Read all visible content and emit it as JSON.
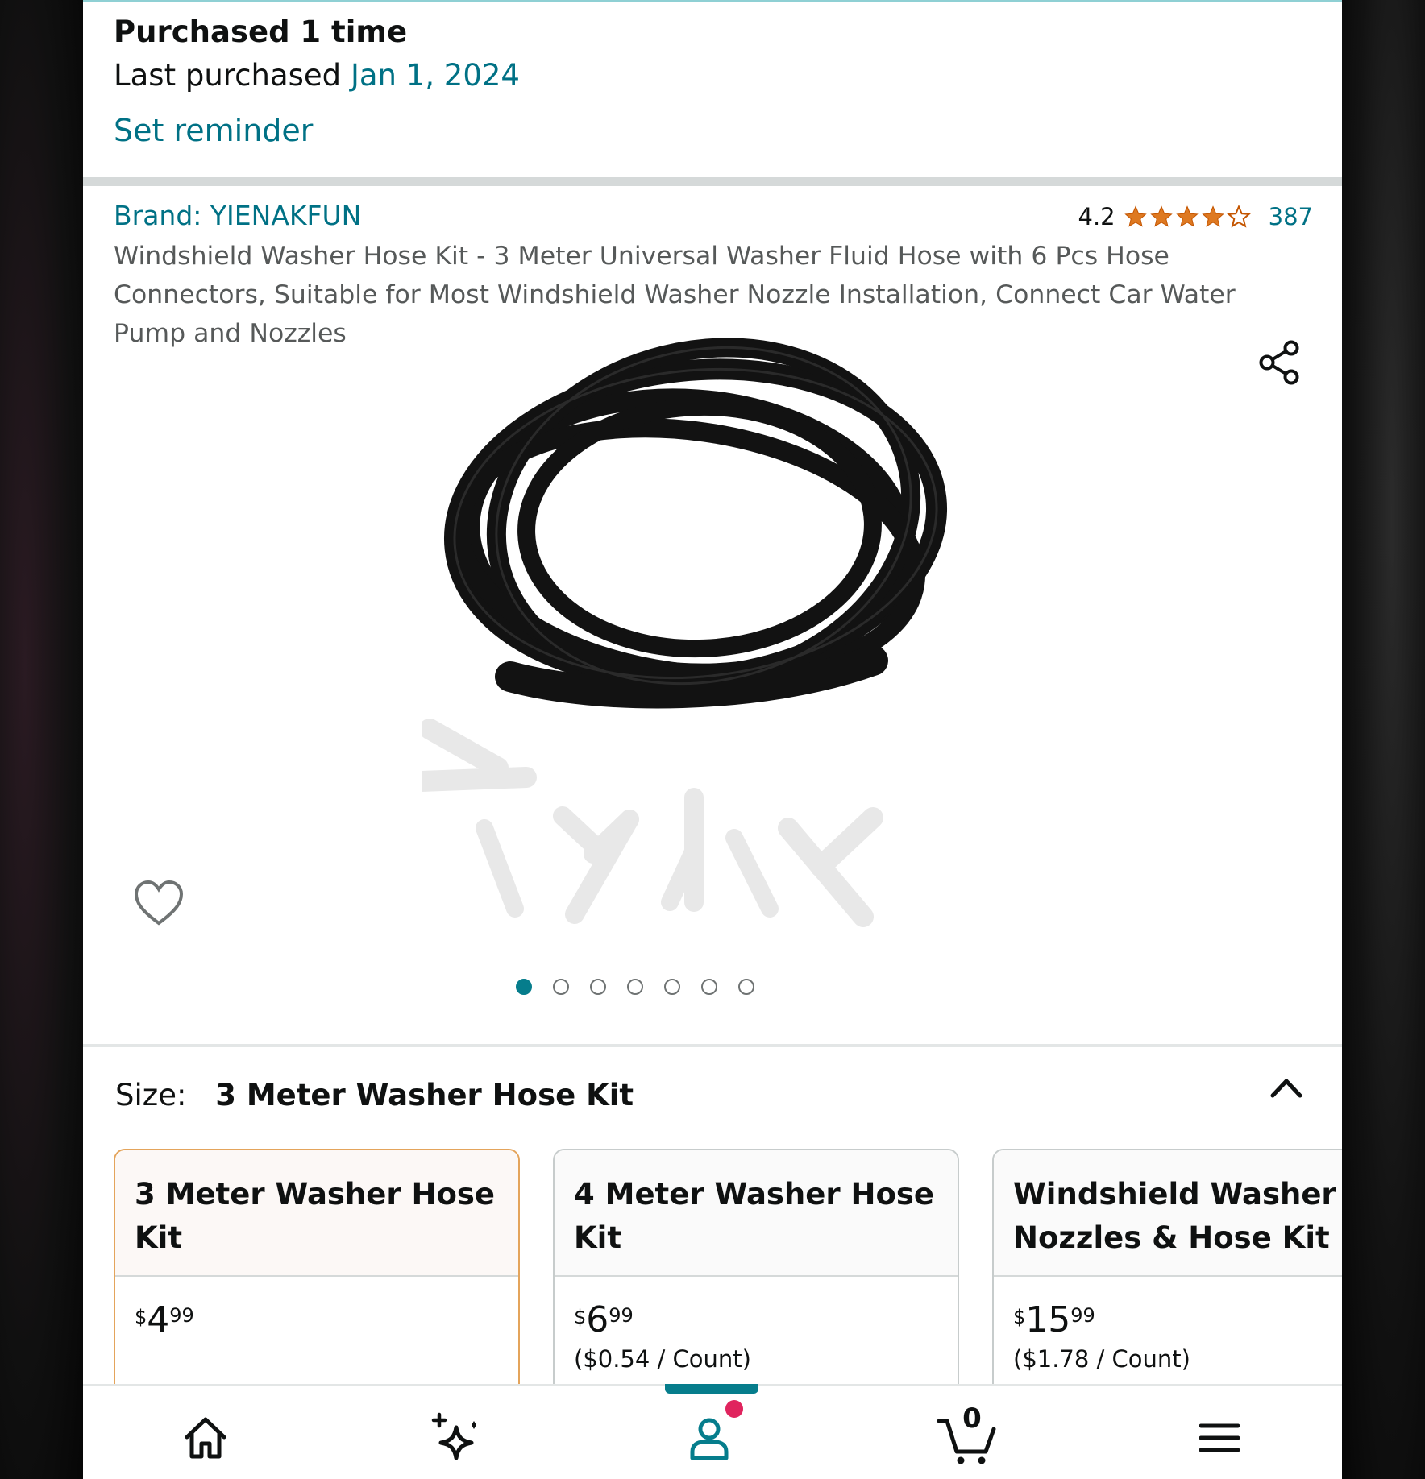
{
  "purchase": {
    "count_text": "Purchased 1 time",
    "last_label": "Last purchased",
    "last_date": "Jan 1, 2024",
    "reminder": "Set reminder"
  },
  "product": {
    "brand": "Brand: YIENAKFUN",
    "rating": "4.2",
    "rating_value": 4.2,
    "review_count": "387",
    "title": "Windshield Washer Hose Kit - 3 Meter Universal Washer Fluid Hose with 6 Pcs Hose Connectors, Suitable for Most Windshield Washer Nozzle Installation, Connect Car Water Pump and Nozzles",
    "image_count": 7,
    "active_image": 1
  },
  "size": {
    "label": "Size:",
    "selected": "3 Meter Washer Hose Kit",
    "options": [
      {
        "name": "3 Meter Washer Hose Kit",
        "currency": "$",
        "price_whole": "4",
        "price_fraction": "99",
        "unit_price": ""
      },
      {
        "name": "4 Meter Washer Hose Kit",
        "currency": "$",
        "price_whole": "6",
        "price_fraction": "99",
        "unit_price": "($0.54 / Count)"
      },
      {
        "name": "Windshield Washer Nozzles & Hose Kit",
        "currency": "$",
        "price_whole": "15",
        "price_fraction": "99",
        "unit_price": "($1.78 / Count)"
      }
    ]
  },
  "nav": {
    "cart_count": "0"
  },
  "colors": {
    "link": "#007185",
    "star": "#de7921",
    "accent": "#067d8c",
    "selected_border": "#e4a45b",
    "badge": "#e0245e"
  }
}
